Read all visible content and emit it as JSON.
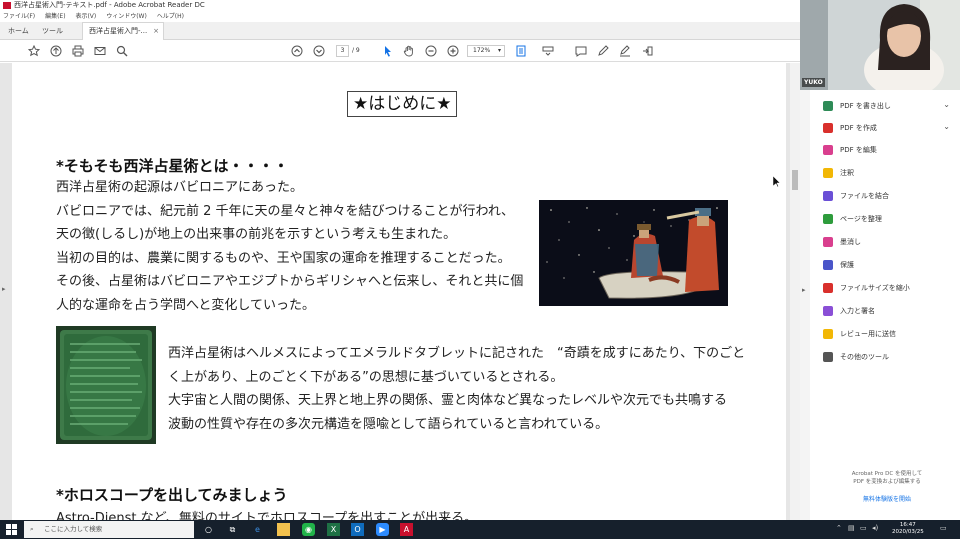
{
  "window": {
    "title": "西洋占星術入門-テキスト.pdf - Adobe Acrobat Reader DC",
    "menu": [
      "ファイル(F)",
      "編集(E)",
      "表示(V)",
      "ウィンドウ(W)",
      "ヘルプ(H)"
    ]
  },
  "tabs": {
    "home": "ホーム",
    "tools": "ツール",
    "document": "西洋占星術入門-...",
    "close": "×"
  },
  "toolbar": {
    "page_current": "3",
    "page_total": "/ 9",
    "zoom": "172%"
  },
  "document": {
    "heading": "★はじめに★",
    "section1_title": "*そもそも西洋占星術とは・・・・",
    "section1_lines": [
      "西洋占星術の起源はバビロニアにあった。",
      "バビロニアでは、紀元前 2 千年に天の星々と神々を結びつけることが行われ、",
      "天の徴(しるし)が地上の出来事の前兆を示すという考えも生まれた。",
      "当初の目的は、農業に関するものや、王や国家の運命を推理することだった。",
      "その後、占星術はバビロニアやエジプトからギリシャへと伝来し、それと共に個",
      "人的な運命を占う学問へと変化していった。"
    ],
    "section1b_lines": [
      "西洋占星術はヘルメスによってエメラルドタブレットに記された　“奇蹟を成すにあたり、下のごと",
      "く上があり、上のごとく下がある”の思想に基づいているとされる。",
      "大宇宙と人間の関係、天上界と地上界の関係、霊と肉体など異なったレベルや次元でも共鳴する",
      "波動の性質や存在の多次元構造を隠喩として語られていると言われている。"
    ],
    "section2_title": "*ホロスコープを出してみましょう",
    "section2_partial": "Astro-Dienst など、無料のサイトでホロスコープを出すことが出来る。"
  },
  "tools_pane": {
    "items": [
      {
        "label": "PDF を書き出し",
        "color": "#2e8b57",
        "chevron": true
      },
      {
        "label": "PDF を作成",
        "color": "#d9302c",
        "chevron": true
      },
      {
        "label": "PDF を編集",
        "color": "#d93f8e",
        "chevron": false
      },
      {
        "label": "注釈",
        "color": "#f2b705",
        "chevron": false
      },
      {
        "label": "ファイルを結合",
        "color": "#6a4fd6",
        "chevron": false
      },
      {
        "label": "ページを整理",
        "color": "#2e9c3c",
        "chevron": false
      },
      {
        "label": "墨消し",
        "color": "#d93f8e",
        "chevron": false
      },
      {
        "label": "保護",
        "color": "#4a55c9",
        "chevron": false
      },
      {
        "label": "ファイルサイズを縮小",
        "color": "#d9302c",
        "chevron": false
      },
      {
        "label": "入力と署名",
        "color": "#8a4fd6",
        "chevron": false
      },
      {
        "label": "レビュー用に送信",
        "color": "#f2b705",
        "chevron": false
      },
      {
        "label": "その他のツール",
        "color": "#555555",
        "chevron": false
      }
    ],
    "promo": "Acrobat Pro DC を使用して\nPDF を変換および編集する",
    "promo_link": "無料体験版を開始"
  },
  "webcam": {
    "name": "YUKO"
  },
  "taskbar": {
    "search_placeholder": "ここに入力して検索",
    "time": "16:47",
    "date": "2020/03/25"
  },
  "colors": {
    "accent": "#1473e6",
    "taskbar": "#16202c",
    "pdf_red": "#c8102e"
  }
}
